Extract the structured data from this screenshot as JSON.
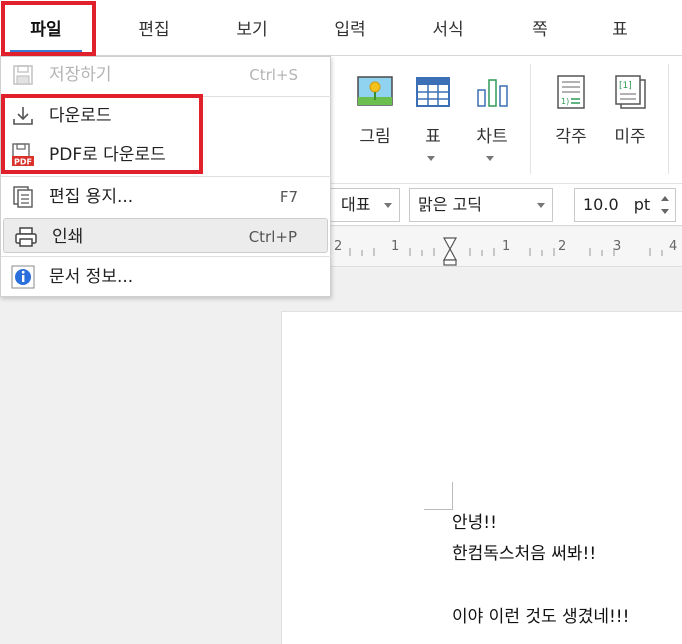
{
  "menubar": {
    "tabs": [
      {
        "label": "파일",
        "active": true
      },
      {
        "label": "편집"
      },
      {
        "label": "보기"
      },
      {
        "label": "입력"
      },
      {
        "label": "서식"
      },
      {
        "label": "쪽"
      },
      {
        "label": "표"
      }
    ]
  },
  "ribbon": {
    "buttons": [
      {
        "label": "그림",
        "icon": "picture-icon"
      },
      {
        "label": "표",
        "icon": "table-icon",
        "has_dropdown": true
      },
      {
        "label": "차트",
        "icon": "chart-icon",
        "has_dropdown": true
      },
      {
        "label": "각주",
        "icon": "footnote-icon"
      },
      {
        "label": "미주",
        "icon": "endnote-icon"
      }
    ]
  },
  "format_bar": {
    "style_value": "대표",
    "font_value": "맑은 고딕",
    "size_value": "10.0",
    "size_unit": "pt"
  },
  "ruler": {
    "ticks": [
      "2",
      "1",
      "1",
      "2",
      "3",
      "4"
    ]
  },
  "file_menu": {
    "items": [
      {
        "label": "저장하기",
        "shortcut": "Ctrl+S",
        "icon": "save-icon",
        "disabled": true
      },
      {
        "label": "다운로드",
        "shortcut": "",
        "icon": "download-icon"
      },
      {
        "label": "PDF로 다운로드",
        "shortcut": "",
        "icon": "pdf-icon"
      },
      {
        "label": "편집 용지...",
        "shortcut": "F7",
        "icon": "page-setup-icon"
      },
      {
        "label": "인쇄",
        "shortcut": "Ctrl+P",
        "icon": "print-icon",
        "hovered": true
      },
      {
        "label": "문서 정보...",
        "shortcut": "",
        "icon": "info-icon"
      }
    ]
  },
  "document": {
    "lines": [
      "안녕!!",
      "한컴독스처음 써봐!!",
      "",
      "이야 이런 것도 생겼네!!!"
    ]
  },
  "colors": {
    "highlight_red": "#e0212b",
    "active_tab_underline": "#3a78d4",
    "info_blue": "#2a6fdb",
    "pdf_red": "#d9322b"
  }
}
